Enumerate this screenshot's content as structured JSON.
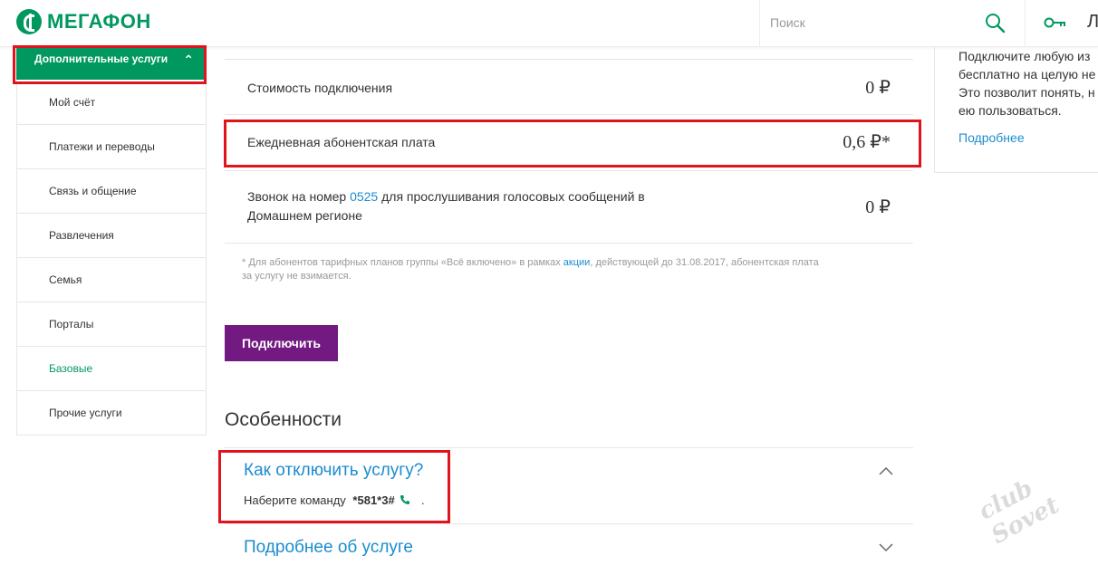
{
  "header": {
    "logo_text": "МегаФон",
    "search_placeholder": "Поиск",
    "login_text": "Л"
  },
  "sidebar": {
    "active_label": "Дополнительные услуги",
    "items": [
      {
        "label": "Мой счёт"
      },
      {
        "label": "Платежи и переводы"
      },
      {
        "label": "Связь и общение"
      },
      {
        "label": "Развлечения"
      },
      {
        "label": "Семья"
      },
      {
        "label": "Порталы"
      },
      {
        "label": "Базовые"
      },
      {
        "label": "Прочие услуги"
      }
    ]
  },
  "main": {
    "rows": [
      {
        "label": "Стоимость подключения",
        "price": "0 ₽"
      },
      {
        "label": "Ежедневная абонентская плата",
        "price": "0,6 ₽*"
      },
      {
        "label_prefix": "Звонок на номер",
        "label_link": "0525",
        "label_suffix": "для прослушивания голосовых сообщений в",
        "label_line2": "Домашнем регионе",
        "price": "0 ₽"
      }
    ],
    "footnote_before": "* Для абонентов тарифных планов группы «Всё включено» в рамках",
    "footnote_link": "акции",
    "footnote_after": ", действующей до 31.08.2017, абонентская плата",
    "footnote_line2": "за услугу не взимается.",
    "connect_button": "Подключить",
    "features_title": "Особенности",
    "accordion": [
      {
        "title": "Как отключить услугу?",
        "body_text": "Наберите команду",
        "body_code": "*581*3#",
        "body_end": "."
      },
      {
        "title": "Подробнее об услуге"
      }
    ]
  },
  "right_panel": {
    "lines": [
      "Подключите любую из",
      "бесплатно на целую не",
      "Это позволит понять, н",
      "ею пользоваться."
    ],
    "link": "Подробнее"
  },
  "colors": {
    "brand_green": "#00985f",
    "button_purple": "#731982",
    "link_blue": "#1b8ccf",
    "highlight_red": "#e1141e"
  },
  "watermark": "club Sovet"
}
